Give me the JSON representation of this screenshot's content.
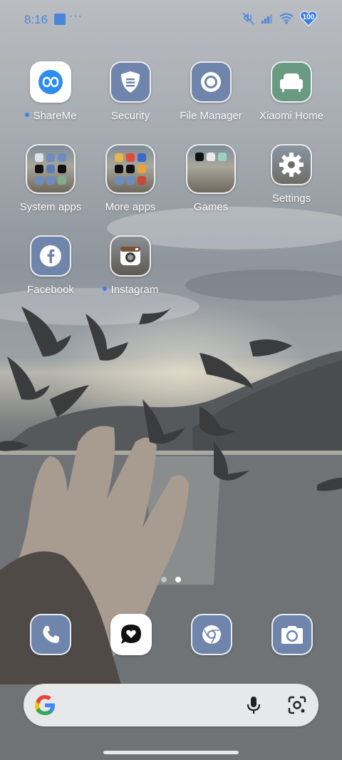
{
  "status_bar": {
    "time": "8:16",
    "overflow": "···",
    "battery_level": "100",
    "icons": [
      "square-notification-icon",
      "mute-icon",
      "signal-icon",
      "wifi-icon",
      "battery-heart-icon"
    ],
    "accent_color": "#4a86d8"
  },
  "apps": [
    {
      "label": "ShareMe",
      "icon": "infinity-icon",
      "new_dot": true
    },
    {
      "label": "Security",
      "icon": "shield-icon",
      "new_dot": false
    },
    {
      "label": "File Manager",
      "icon": "ring-icon",
      "new_dot": false
    },
    {
      "label": "Xiaomi Home",
      "icon": "sofa-icon",
      "new_dot": false
    },
    {
      "label": "System apps",
      "icon": "folder-icon",
      "new_dot": false
    },
    {
      "label": "More apps",
      "icon": "folder-icon",
      "new_dot": false
    },
    {
      "label": "Games",
      "icon": "folder-icon",
      "new_dot": false
    },
    {
      "label": "Settings",
      "icon": "gear-icon",
      "new_dot": false
    },
    {
      "label": "Facebook",
      "icon": "facebook-icon",
      "new_dot": false
    },
    {
      "label": "Instagram",
      "icon": "camera-icon",
      "new_dot": true
    }
  ],
  "page_indicator": {
    "pages": 2,
    "current": 2
  },
  "dock": [
    {
      "icon": "phone-icon"
    },
    {
      "icon": "message-heart-icon"
    },
    {
      "icon": "chrome-icon"
    },
    {
      "icon": "camera-icon"
    }
  ],
  "search": {
    "icons": [
      "google-g-icon",
      "microphone-icon",
      "lens-icon"
    ],
    "colors": {
      "blue": "#4285f4",
      "red": "#ea4335",
      "yellow": "#fbbc05",
      "green": "#34a853"
    }
  }
}
